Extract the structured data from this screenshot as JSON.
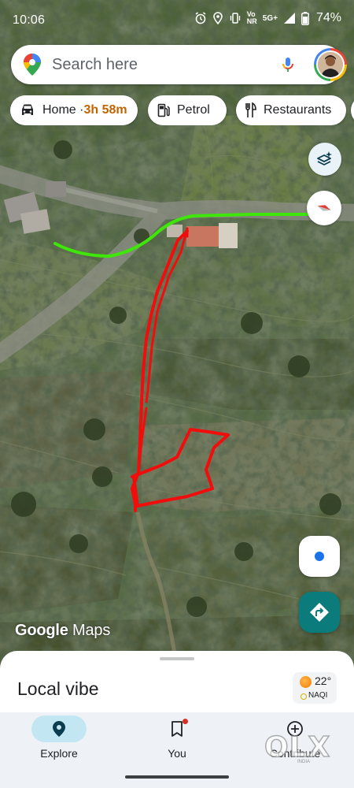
{
  "status_bar": {
    "time": "10:06",
    "network_top": "5G+",
    "vo_lte": "Vo",
    "network_bottom": "NR",
    "battery": "74%"
  },
  "search": {
    "placeholder": "Search here",
    "leading_icon": "google-maps-pin-icon",
    "mic_icon": "mic-icon",
    "avatar": "user-avatar"
  },
  "chips": [
    {
      "icon": "car-icon",
      "label": "Home · ",
      "eta": "3h 58m"
    },
    {
      "icon": "fuel-pump-icon",
      "label": "Petrol"
    },
    {
      "icon": "fork-knife-icon",
      "label": "Restaurants"
    },
    {
      "icon": "hotel-icon",
      "label": ""
    }
  ],
  "map": {
    "layers_icon": "layers-icon",
    "compass_icon": "compass-icon",
    "location_icon": "my-location-icon",
    "directions_icon": "directions-icon",
    "logo_word1": "Google",
    "logo_word2": " Maps",
    "annotation_colors": {
      "route": "#3ee60a",
      "drawing": "#f20d0d"
    }
  },
  "sheet": {
    "title": "Local vibe",
    "temperature": "22°",
    "aqi": "NAQI"
  },
  "nav": {
    "explore": "Explore",
    "you": "You",
    "contribute": "Contribute"
  },
  "watermark": {
    "brand": "OLX",
    "sub": "INDIA"
  }
}
